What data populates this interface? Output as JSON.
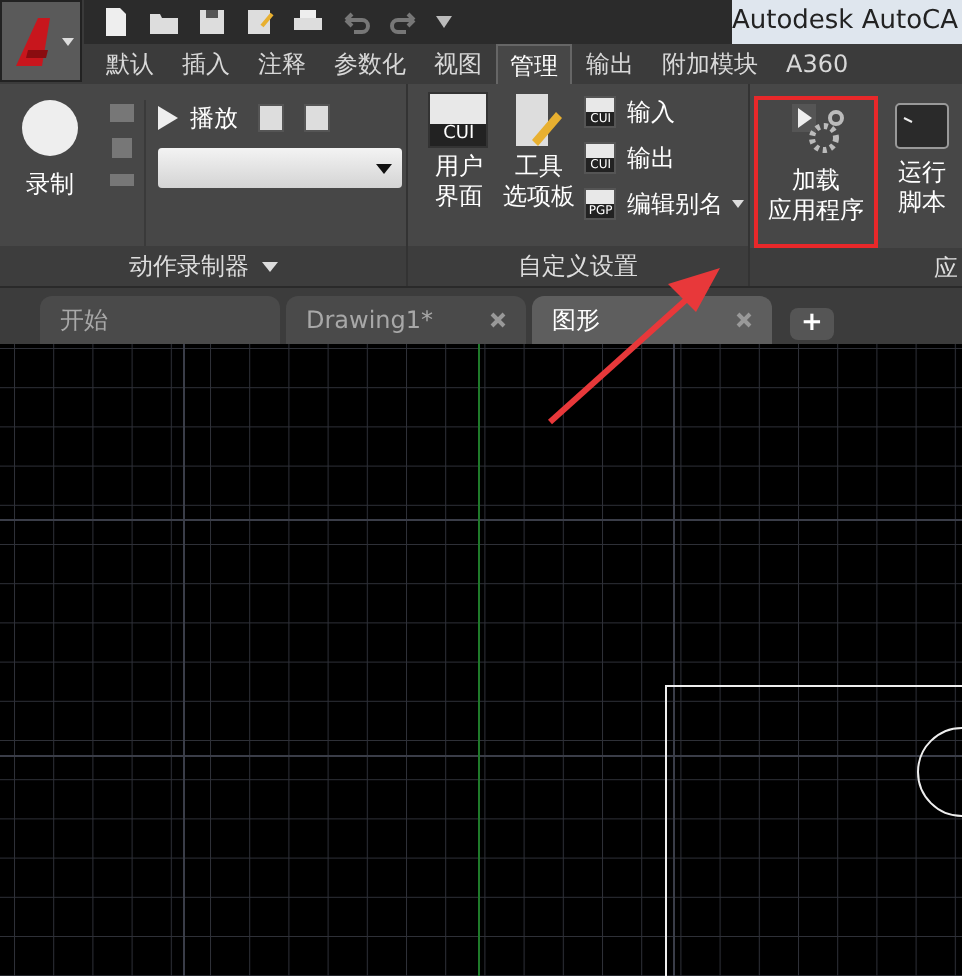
{
  "window": {
    "title": "Autodesk AutoCA"
  },
  "ribbon_tabs": [
    {
      "label": "默认",
      "selected": false
    },
    {
      "label": "插入",
      "selected": false
    },
    {
      "label": "注释",
      "selected": false
    },
    {
      "label": "参数化",
      "selected": false
    },
    {
      "label": "视图",
      "selected": false
    },
    {
      "label": "管理",
      "selected": true
    },
    {
      "label": "输出",
      "selected": false
    },
    {
      "label": "附加模块",
      "selected": false
    },
    {
      "label": "A360",
      "selected": false
    }
  ],
  "panels": [
    {
      "title": "动作录制器",
      "has_menu": true,
      "record_label": "录制",
      "play_label": "播放"
    },
    {
      "title": "自定义设置",
      "large_buttons": [
        {
          "lines": [
            "用户",
            "界面"
          ],
          "icon_text": "CUI"
        },
        {
          "lines": [
            "工具",
            "选项板"
          ]
        }
      ],
      "small_buttons": [
        {
          "label": "输入",
          "icon_text": "CUI"
        },
        {
          "label": "输出",
          "icon_text": "CUI"
        },
        {
          "label": "编辑别名",
          "icon_text": "PGP",
          "has_menu": true
        }
      ]
    },
    {
      "title": "应",
      "large_buttons": [
        {
          "lines": [
            "加载",
            "应用程序"
          ],
          "highlighted": true
        },
        {
          "lines": [
            "运行",
            "脚本"
          ],
          "highlighted": false
        }
      ]
    }
  ],
  "file_tabs": [
    {
      "label": "开始",
      "selected": false,
      "closable": false
    },
    {
      "label": "Drawing1*",
      "selected": false,
      "closable": true
    },
    {
      "label": "图形",
      "selected": true,
      "closable": true
    }
  ],
  "new_tab": {
    "label": "+"
  }
}
